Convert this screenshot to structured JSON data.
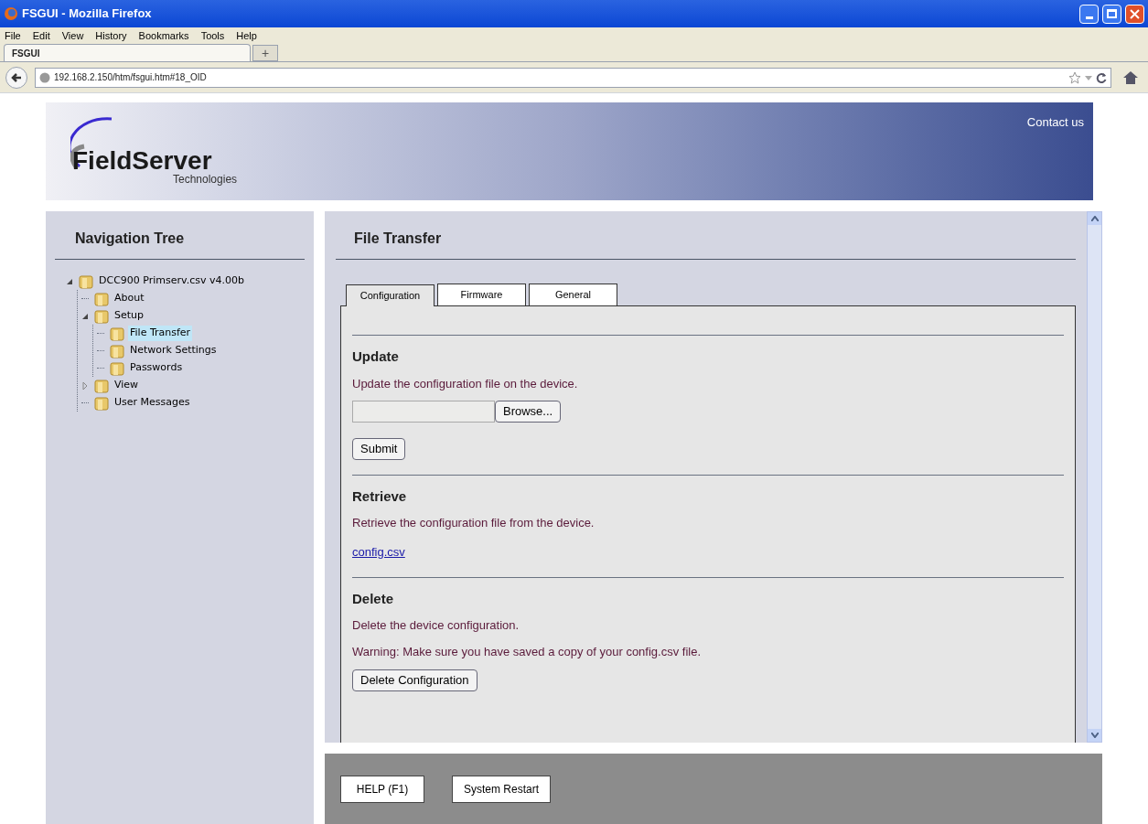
{
  "window": {
    "title": "FSGUI - Mozilla Firefox"
  },
  "menu": [
    "File",
    "Edit",
    "View",
    "History",
    "Bookmarks",
    "Tools",
    "Help"
  ],
  "browser_tab": {
    "title": "FSGUI",
    "new_tab": "+"
  },
  "address": "192.168.2.150/htm/fsgui.htm#18_OID",
  "header": {
    "logo_main": "FieldServer",
    "logo_sub": "Technologies",
    "contact": "Contact us"
  },
  "sidebar": {
    "title": "Navigation Tree",
    "tree": [
      {
        "label": "DCC900 Primserv.csv v4.00b",
        "expanded": true,
        "selected": false,
        "children": [
          {
            "label": "About",
            "selected": false
          },
          {
            "label": "Setup",
            "expanded": true,
            "selected": false,
            "children": [
              {
                "label": "File Transfer",
                "selected": true
              },
              {
                "label": "Network Settings",
                "selected": false
              },
              {
                "label": "Passwords",
                "selected": false
              }
            ]
          },
          {
            "label": "View",
            "expanded": false,
            "selected": false
          },
          {
            "label": "User Messages",
            "selected": false
          }
        ]
      }
    ]
  },
  "main": {
    "title": "File Transfer",
    "tabs": [
      {
        "label": "Configuration",
        "selected": true
      },
      {
        "label": "Firmware",
        "selected": false
      },
      {
        "label": "General",
        "selected": false
      }
    ],
    "sections": [
      {
        "kind": "upload",
        "heading": "Update",
        "lines": [
          "Update the configuration file on the device."
        ],
        "browse": "Browse...",
        "button": "Submit"
      },
      {
        "kind": "link",
        "heading": "Retrieve",
        "lines": [
          "Retrieve the configuration file from the device."
        ],
        "link": "config.csv"
      },
      {
        "kind": "action",
        "heading": "Delete",
        "lines": [
          "Delete the device configuration.",
          "Warning: Make sure you have saved a copy of your config.csv file."
        ],
        "button": "Delete Configuration"
      }
    ]
  },
  "footer": {
    "buttons": [
      "HELP (F1)",
      "System Restart"
    ]
  }
}
